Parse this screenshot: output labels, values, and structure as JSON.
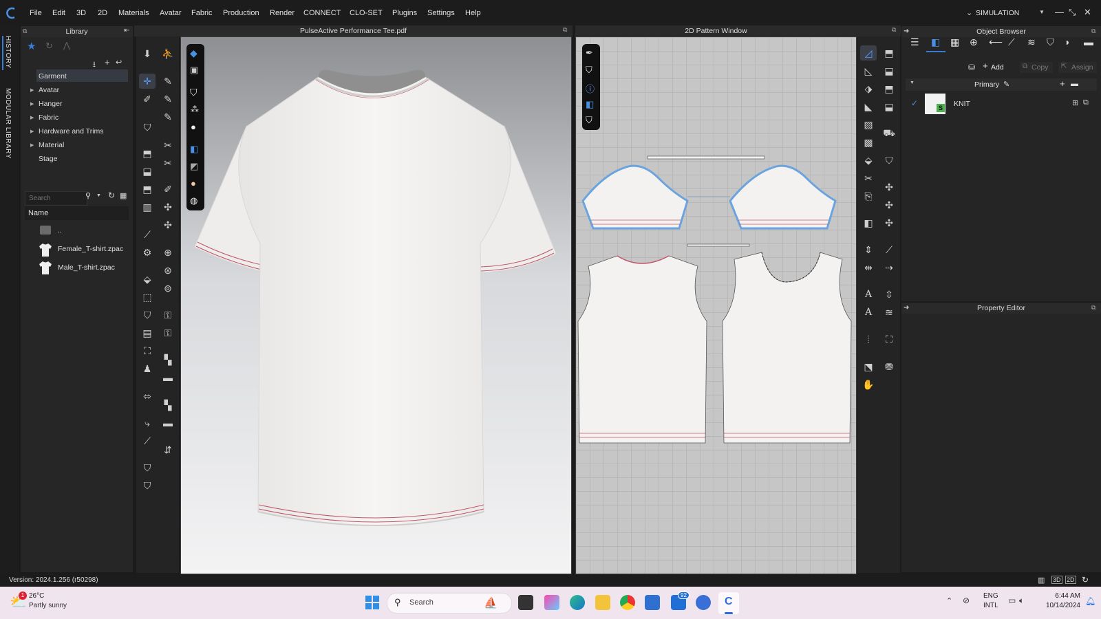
{
  "menubar": {
    "items": [
      "File",
      "Edit",
      "3D",
      "2D",
      "Materials",
      "Avatar",
      "Fabric",
      "Production",
      "Render",
      "CONNECT",
      "CLO-SET",
      "Plugins",
      "Settings",
      "Help"
    ],
    "mode": "SIMULATION"
  },
  "side_tabs": [
    "HISTORY",
    "MODULAR LIBRARY"
  ],
  "library": {
    "title": "Library",
    "tree": [
      "Garment",
      "Avatar",
      "Hanger",
      "Fabric",
      "Hardware and Trims",
      "Material",
      "Stage"
    ],
    "search_placeholder": "Search",
    "list_header": "Name",
    "files": [
      "..",
      "Female_T-shirt.zpac",
      "Male_T-shirt.zpac"
    ]
  },
  "viewport3d": {
    "title": "PulseActive Performance Tee.pdf"
  },
  "pattern2d": {
    "title": "2D Pattern Window"
  },
  "object_browser": {
    "title": "Object Browser",
    "add_label": "Add",
    "copy_label": "Copy",
    "assign_label": "Assign",
    "section": "Primary",
    "fabric_name": "KNIT"
  },
  "property_editor": {
    "title": "Property Editor"
  },
  "status": {
    "version": "Version: 2024.1.256 (r50298)"
  },
  "taskbar": {
    "weather_temp": "26°C",
    "weather_desc": "Partly sunny",
    "weather_badge": "1",
    "search_placeholder": "Search",
    "mail_badge": "92",
    "lang1": "ENG",
    "lang2": "INTL",
    "time": "6:44 AM",
    "date": "10/14/2024"
  },
  "colors": {
    "accent": "#3a7bd5",
    "shirt": "#f2f1ef",
    "seam": "#c0566a",
    "pattern_outline": "#6aa3dd"
  }
}
